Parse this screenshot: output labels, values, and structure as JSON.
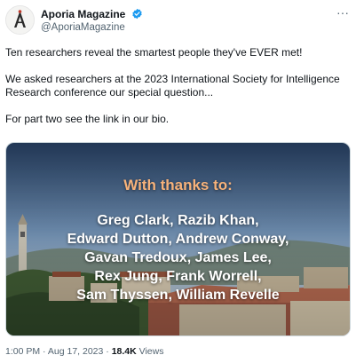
{
  "author": {
    "name": "Aporia Magazine",
    "handle": "@AporiaMagazine",
    "verified_icon": "verified-badge-icon",
    "avatar_icon": "aporia-logo"
  },
  "header": {
    "more_label": "···"
  },
  "tweet": {
    "paragraphs": [
      "Ten researchers reveal the smartest people they've EVER met!",
      "We asked researchers at the 2023 International Society for Intelligence Research conference our special question...",
      "For part two see the link in our bio."
    ]
  },
  "media": {
    "heading": "With thanks to:",
    "name_lines": [
      "Greg Clark, Razib Khan,",
      "Edward Dutton, Andrew Conway,",
      "Gavan Tredoux, James Lee,",
      "Rex Jung, Frank Worrell,",
      "Sam Thyssen, William Revelle"
    ],
    "heading_color": "#f7b27a"
  },
  "meta": {
    "time": "1:00 PM",
    "separator": "·",
    "date": "Aug 17, 2023",
    "views_count": "18.4K",
    "views_label": "Views"
  },
  "colors": {
    "accent": "#1d9bf0",
    "secondary_text": "#536471"
  }
}
